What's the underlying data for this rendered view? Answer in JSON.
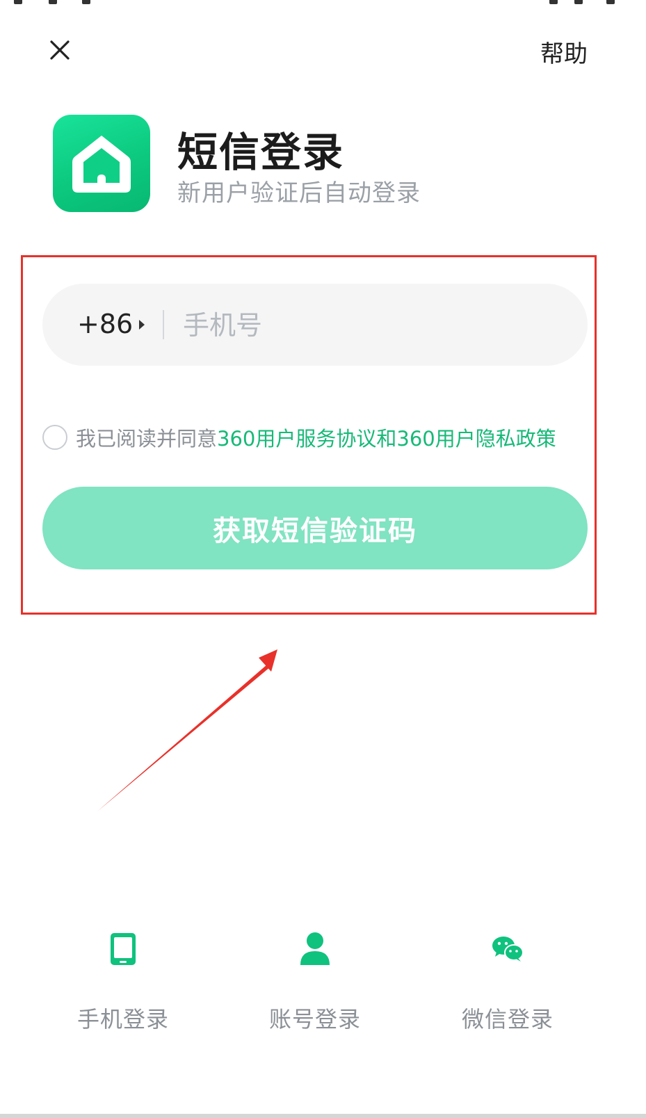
{
  "header": {
    "close_label": "×",
    "help_label": "帮助"
  },
  "hero": {
    "title": "短信登录",
    "subtitle": "新用户验证后自动登录",
    "logo_icon": "house-icon"
  },
  "form": {
    "country_code": "+86",
    "phone_placeholder": "手机号",
    "phone_value": "",
    "agree_prefix": "我已阅读并同意 ",
    "terms_link": "360用户服务协议",
    "agree_and": "和",
    "privacy_link": "360用户隐私政策",
    "submit_label": "获取短信验证码"
  },
  "login_options": [
    {
      "label": "手机登录",
      "icon": "phone-icon"
    },
    {
      "label": "账号登录",
      "icon": "user-icon"
    },
    {
      "label": "微信登录",
      "icon": "wechat-icon"
    }
  ],
  "colors": {
    "brand_green": "#17b978",
    "button_disabled": "#80e3c2",
    "annotation_red": "#e8312a"
  }
}
